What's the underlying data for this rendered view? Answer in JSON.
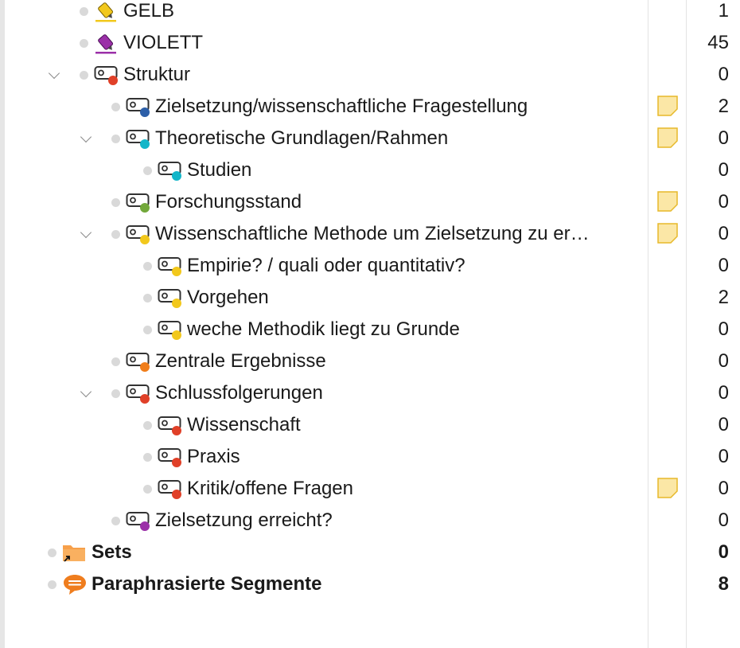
{
  "tree": {
    "rows": [
      {
        "label": "GELB",
        "count": "1",
        "icon": "yellow-highlighter-icon",
        "dot": "#e6b800"
      },
      {
        "label": "VIOLETT",
        "count": "45",
        "icon": "violet-highlighter-icon",
        "dot": "#9b30a8"
      },
      {
        "label": "Struktur",
        "count": "0",
        "icon": "code-icon",
        "dot": "#e04028"
      },
      {
        "label": "Zielsetzung/wissenschaftliche Fragestellung",
        "count": "2",
        "icon": "code-icon",
        "dot": "#2c5fa8"
      },
      {
        "label": "Theoretische Grundlagen/Rahmen",
        "count": "0",
        "icon": "code-icon",
        "dot": "#12b6c9"
      },
      {
        "label": "Studien",
        "count": "0",
        "icon": "code-icon",
        "dot": "#12b6c9"
      },
      {
        "label": "Forschungsstand",
        "count": "0",
        "icon": "code-icon",
        "dot": "#72a83a"
      },
      {
        "label": "Wissenschaftliche Methode um Zielsetzung zu er…",
        "count": "0",
        "icon": "code-icon",
        "dot": "#f2c81c"
      },
      {
        "label": "Empirie? / quali oder quantitativ?",
        "count": "0",
        "icon": "code-icon",
        "dot": "#f2c81c"
      },
      {
        "label": "Vorgehen",
        "count": "2",
        "icon": "code-icon",
        "dot": "#f2c81c"
      },
      {
        "label": "weche Methodik liegt zu Grunde",
        "count": "0",
        "icon": "code-icon",
        "dot": "#f2c81c"
      },
      {
        "label": "Zentrale Ergebnisse",
        "count": "0",
        "icon": "code-icon",
        "dot": "#f07d1a"
      },
      {
        "label": "Schlussfolgerungen",
        "count": "0",
        "icon": "code-icon",
        "dot": "#e04028"
      },
      {
        "label": "Wissenschaft",
        "count": "0",
        "icon": "code-icon",
        "dot": "#e04028"
      },
      {
        "label": "Praxis",
        "count": "0",
        "icon": "code-icon",
        "dot": "#e04028"
      },
      {
        "label": "Kritik/offene Fragen",
        "count": "0",
        "icon": "code-icon",
        "dot": "#e04028"
      },
      {
        "label": "Zielsetzung erreicht?",
        "count": "0",
        "icon": "code-icon",
        "dot": "#9b30a8"
      },
      {
        "label": "Sets",
        "count": "0",
        "icon": "sets-folder-icon"
      },
      {
        "label": "Paraphrasierte Segmente",
        "count": "8",
        "icon": "paraphrase-speech-bubble-icon"
      }
    ]
  },
  "colors": {
    "memo_fill": "#fbe7a6",
    "memo_border": "#e7b92a",
    "folder_orange": "#f7a04a",
    "paraphrase_orange": "#ef7d1e"
  }
}
